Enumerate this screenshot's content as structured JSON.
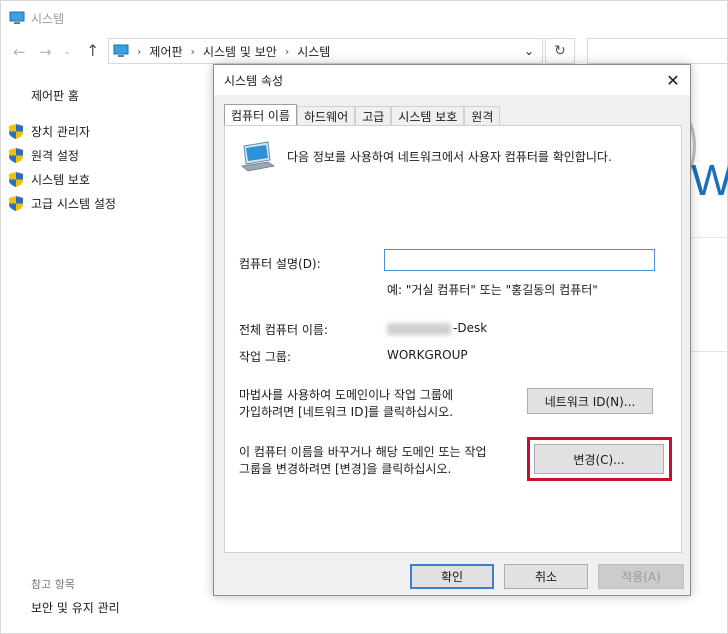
{
  "window": {
    "title": "시스템",
    "breadcrumb": [
      "제어판",
      "시스템 및 보안",
      "시스템"
    ]
  },
  "sidebar": {
    "home": "제어판 홈",
    "links": [
      "장치 관리자",
      "원격 설정",
      "시스템 보호",
      "고급 시스템 설정"
    ],
    "see_also_heading": "참고 항목",
    "see_also_link": "보안 및 유지 관리"
  },
  "background_partial": "W",
  "dialog": {
    "title": "시스템 속성",
    "tabs": [
      "컴퓨터 이름",
      "하드웨어",
      "고급",
      "시스템 보호",
      "원격"
    ],
    "info_text": "다음 정보를 사용하여 네트워크에서 사용자 컴퓨터를 확인합니다.",
    "description_label": "컴퓨터 설명(D):",
    "description_value": "",
    "example_text": "예: \"거실 컴퓨터\" 또는 \"홍길동의 컴퓨터\"",
    "full_name_label": "전체 컴퓨터 이름:",
    "full_name_value_suffix": "-Desk",
    "workgroup_label": "작업 그룹:",
    "workgroup_value": "WORKGROUP",
    "network_text_line1": "마법사를 사용하여 도메인이나 작업 그룹에",
    "network_text_line2": "가입하려면 [네트워크 ID]를 클릭하십시오.",
    "network_id_button": "네트워크 ID(N)...",
    "change_text_line1": "이 컴퓨터 이름을 바꾸거나 해당 도메인 또는 작업",
    "change_text_line2": "그룹을 변경하려면 [변경]을 클릭하십시오.",
    "change_button": "변경(C)...",
    "ok_button": "확인",
    "cancel_button": "취소",
    "apply_button": "적용(A)"
  },
  "colors": {
    "highlight": "#c8102e",
    "accent": "#3c7fd0"
  }
}
